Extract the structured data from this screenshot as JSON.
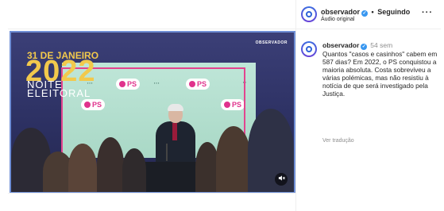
{
  "post": {
    "video": {
      "date_text": "31 DE JANEIRO",
      "year_text": "2022",
      "noite_text": "NOITE",
      "eleitoral_text": "ELEITORAL",
      "watermark": "OBSERVADOR",
      "ps_badge": "PS",
      "mute_icon": "speaker-muted-icon"
    }
  },
  "header": {
    "username": "observador",
    "separator": "•",
    "follow_status": "Seguindo",
    "audio_label": "Áudio original",
    "more_icon": "more-options-icon"
  },
  "caption": {
    "username": "observador",
    "time": "54 sem",
    "text": "Quantos \"casos e casinhos\" cabem em 587 dias? Em 2022, o PS conquistou a maioria absoluta. Costa sobreviveu a várias polémicas, mas não resistiu à notícia de que será investigado pela Justiça.",
    "translate_label": "Ver tradução"
  },
  "colors": {
    "accent_blue": "#3897f0",
    "ps_pink": "#e0338d",
    "title_yellow": "#f2c94c",
    "video_bg": "#2d3163"
  }
}
